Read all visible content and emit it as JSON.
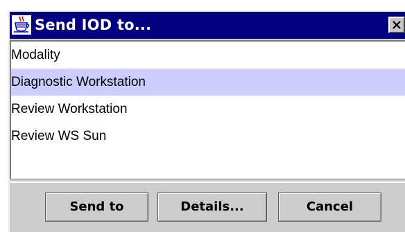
{
  "window": {
    "title": "Send IOD to...",
    "title_icon": "java-coffee-cup-icon",
    "close_icon": "close-x-icon"
  },
  "list": {
    "items": [
      {
        "label": "Modality",
        "selected": false
      },
      {
        "label": "Diagnostic Workstation",
        "selected": true
      },
      {
        "label": "Review Workstation",
        "selected": false
      },
      {
        "label": "Review WS Sun",
        "selected": false
      }
    ]
  },
  "buttons": {
    "send_label": "Send to",
    "details_label": "Details...",
    "cancel_label": "Cancel"
  },
  "colors": {
    "titlebar": "#000080",
    "selection": "#ccccff",
    "dialog_bg": "#cccccc"
  }
}
